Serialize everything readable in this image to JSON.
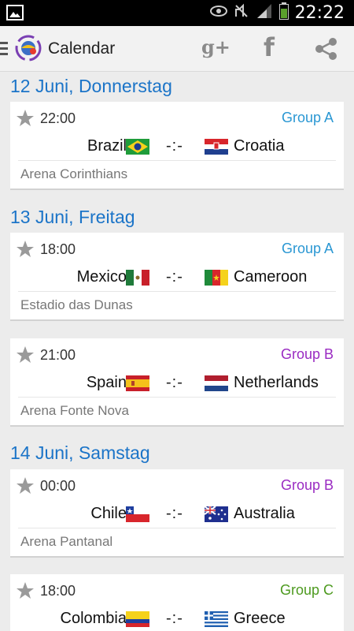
{
  "status_bar": {
    "time": "22:22",
    "icons": [
      "image-icon",
      "eye-icon",
      "mute-icon",
      "signal-icon",
      "battery-icon"
    ]
  },
  "action_bar": {
    "title": "Calendar",
    "actions": [
      "google-plus-icon",
      "facebook-icon",
      "share-icon"
    ]
  },
  "colors": {
    "accent_blue": "#1b74c8",
    "group_a": "#2a97d3",
    "group_b": "#9a2bc2",
    "group_c": "#4d9a1f"
  },
  "days": [
    {
      "date": "12 Juni, Donnerstag",
      "matches": [
        {
          "time": "22:00",
          "group": "Group A",
          "home": "Brazil",
          "away": "Croatia",
          "score": "-:-",
          "venue": "Arena Corinthians"
        }
      ]
    },
    {
      "date": "13 Juni, Freitag",
      "matches": [
        {
          "time": "18:00",
          "group": "Group A",
          "home": "Mexico",
          "away": "Cameroon",
          "score": "-:-",
          "venue": "Estadio das Dunas"
        },
        {
          "time": "21:00",
          "group": "Group B",
          "home": "Spain",
          "away": "Netherlands",
          "score": "-:-",
          "venue": "Arena Fonte Nova"
        }
      ]
    },
    {
      "date": "14 Juni, Samstag",
      "matches": [
        {
          "time": "00:00",
          "group": "Group B",
          "home": "Chile",
          "away": "Australia",
          "score": "-:-",
          "venue": "Arena Pantanal"
        },
        {
          "time": "18:00",
          "group": "Group C",
          "home": "Colombia",
          "away": "Greece",
          "score": "-:-",
          "venue": ""
        }
      ]
    }
  ]
}
